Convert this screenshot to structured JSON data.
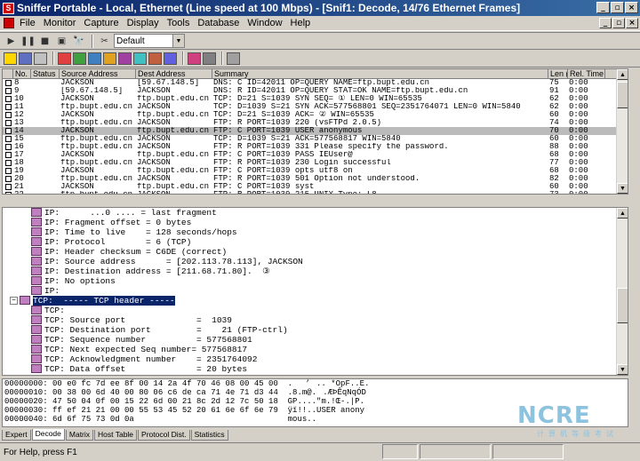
{
  "window": {
    "title": "Sniffer Portable - Local, Ethernet (Line speed at 100 Mbps) - [Snif1: Decode, 14/76 Ethernet Frames]"
  },
  "menu": [
    "File",
    "Monitor",
    "Capture",
    "Display",
    "Tools",
    "Database",
    "Window",
    "Help"
  ],
  "toolbar": {
    "profile": "Default"
  },
  "packet_list": {
    "columns": [
      "No.",
      "Status",
      "Source Address",
      "Dest Address",
      "Summary",
      "Len (B)",
      "Rel. Time"
    ],
    "rows": [
      [
        "8",
        "",
        "JACKSON",
        "[59.67.148.5]",
        "DNS: C ID=42011 OP=QUERY NAME=ftp.bupt.edu.cn",
        "75",
        "0:00"
      ],
      [
        "9",
        "",
        "[59.67.148.5]",
        "JACKSON",
        "DNS: R ID=42011 OP=QUERY STAT=OK NAME=ftp.bupt.edu.cn",
        "91",
        "0:00"
      ],
      [
        "10",
        "",
        "JACKSON",
        "ftp.bupt.edu.cn",
        "TCP: D=21 S=1039 SYN SEQ=   ①          LEN=0 WIN=65535",
        "62",
        "0:00"
      ],
      [
        "11",
        "",
        "ftp.bupt.edu.cn",
        "JACKSON",
        "TCP: D=1039 S=21 SYN ACK=577568801 SEQ=2351764071 LEN=0 WIN=5840",
        "62",
        "0:00"
      ],
      [
        "12",
        "",
        "JACKSON",
        "ftp.bupt.edu.cn",
        "TCP: D=21 S=1039     ACK=   ②          WIN=65535",
        "60",
        "0:00"
      ],
      [
        "13",
        "",
        "ftp.bupt.edu.cn",
        "JACKSON",
        "FTP: R PORT=1039    220 (vsFTPd 2.0.5)",
        "74",
        "0:00"
      ],
      [
        "14",
        "",
        "JACKSON",
        "ftp.bupt.edu.cn",
        "FTP: C PORT=1039    USER anonymous",
        "70",
        "0:00"
      ],
      [
        "15",
        "",
        "ftp.bupt.edu.cn",
        "JACKSON",
        "TCP: D=1039 S=21     ACK=577568817 WIN=5840",
        "60",
        "0:00"
      ],
      [
        "16",
        "",
        "ftp.bupt.edu.cn",
        "JACKSON",
        "FTP: R PORT=1039    331 Please specify the password.",
        "88",
        "0:00"
      ],
      [
        "17",
        "",
        "JACKSON",
        "ftp.bupt.edu.cn",
        "FTP: C PORT=1039    PASS IEUser@",
        "68",
        "0:00"
      ],
      [
        "18",
        "",
        "ftp.bupt.edu.cn",
        "JACKSON",
        "FTP: R PORT=1039    230 Login successful",
        "77",
        "0:00"
      ],
      [
        "19",
        "",
        "JACKSON",
        "ftp.bupt.edu.cn",
        "FTP: C PORT=1039    opts utf8 on",
        "68",
        "0:00"
      ],
      [
        "20",
        "",
        "ftp.bupt.edu.cn",
        "JACKSON",
        "FTP: R PORT=1039    501 Option not understood.",
        "82",
        "0:00"
      ],
      [
        "21",
        "",
        "JACKSON",
        "ftp.bupt.edu.cn",
        "FTP: C PORT=1039    syst",
        "60",
        "0:00"
      ],
      [
        "22",
        "",
        "ftp.bupt.edu.cn",
        "JACKSON",
        "FTP: R PORT=1039    215 UNIX Type: L8",
        "73",
        "0:00"
      ]
    ]
  },
  "decode": {
    "ip_lines": [
      "IP:      ...0 .... = last fragment",
      "IP: Fragment offset = 0 bytes",
      "IP: Time to live    = 128 seconds/hops",
      "IP: Protocol        = 6 (TCP)",
      "IP: Header checksum = C6DE (correct)",
      "IP: Source address      = [202.113.78.113], JACKSON",
      "IP: Destination address = [211.68.71.80].  ③",
      "IP: No options",
      "IP:"
    ],
    "tcp_header": "TCP:  ----- TCP header -----",
    "tcp_lines": [
      "TCP:",
      "TCP: Source port              =  1039",
      "TCP: Destination port         =    21 (FTP-ctrl)",
      "TCP: Sequence number          = 577568801",
      "TCP: Next expected Seq number= 577568817",
      "TCP: Acknowledgment number    = 2351764092",
      "TCP: Data offset              = 20 bytes"
    ]
  },
  "hex": [
    "00000000: 00 e0 fc 7d ee 8f 00 14 2a 4f 70 46 08 00 45 00  .’.. *OpF..E.",
    "00000010: 00 38 00 6d 40 00 80 06 c6 de ca 71 4e 71 d3 44  .8.m@..ÆÞÊqNqÓD",
    "00000020: 47 50 04 0f 00 15 22 6d 00 21 8c 2d 12 7c 50 18  GP....\"m.!Œ-.|P.",
    "00000030: ff ef 21 21 00 00 55 53 45 52 20 61 6e 6f 6e 79  ÿï!!..USER anony",
    "00000040: 6d 6f 75 73 0d 0a                                mous.."
  ],
  "tabs": [
    "Expert",
    "Decode",
    "Matrix",
    "Host Table",
    "Protocol Dist.",
    "Statistics"
  ],
  "status": {
    "help": "For Help, press F1"
  },
  "watermark": {
    "brand": "NCRE",
    "tagline": "计算机等级考试"
  }
}
